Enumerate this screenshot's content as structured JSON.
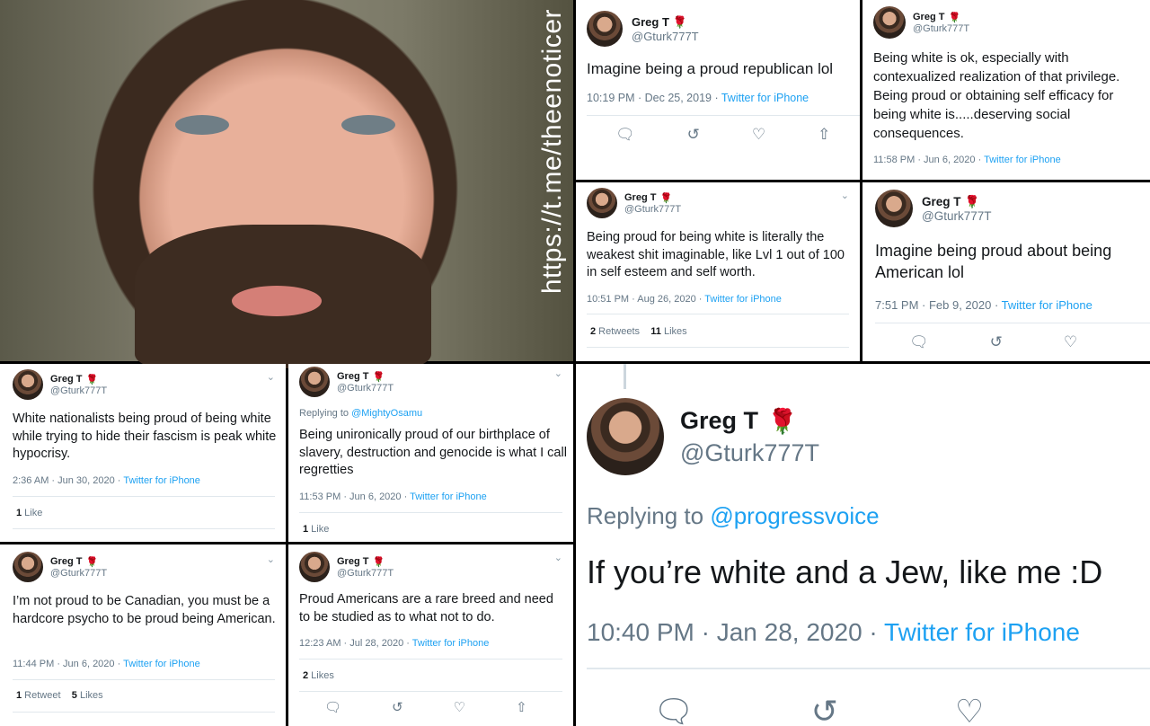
{
  "photo": {
    "watermark": "https://t.me/theenoticer"
  },
  "user": {
    "name": "Greg T",
    "handle": "@Gturk777T",
    "rose": "🌹"
  },
  "source": "Twitter for iPhone",
  "t1": {
    "text": "Imagine being a proud republican lol",
    "time": "10:19 PM · Dec 25, 2019 · "
  },
  "t2": {
    "text": "Being white is ok, especially with contexualized realization of that privilege. Being proud or obtaining self efficacy for being white is.....deserving social consequences.",
    "time": "11:58 PM · Jun 6, 2020 · "
  },
  "t3": {
    "text": "Being proud for being white is literally the weakest shit imaginable, like Lvl 1 out of 100 in self esteem and self worth.",
    "time": "10:51 PM · Aug 26, 2020 · ",
    "retweets": "2",
    "retweets_label": " Retweets",
    "likes": "11",
    "likes_label": " Likes"
  },
  "t4": {
    "text": "Imagine being proud about being American lol",
    "time": "7:51 PM · Feb 9, 2020 · "
  },
  "t5": {
    "text": "White nationalists being proud of being white while trying to hide their fascism is peak white hypocrisy.",
    "time": "2:36 AM · Jun 30, 2020 · ",
    "likes": "1",
    "likes_label": " Like"
  },
  "t6": {
    "replying": "Replying to ",
    "replying_to": "@MightyOsamu",
    "text": "Being unironically proud of our birthplace of slavery, destruction and genocide is what I call regretties",
    "time": "11:53 PM · Jun 6, 2020 · ",
    "likes": "1",
    "likes_label": " Like"
  },
  "t7": {
    "replying": "Replying to ",
    "replying_to": "@progressvoice",
    "text": "If you’re white and a Jew, like me :D",
    "time": "10:40 PM · Jan 28, 2020 · "
  },
  "t8": {
    "text": "I’m not proud to be Canadian, you must be a hardcore psycho to be proud being American.",
    "time": "11:44 PM · Jun 6, 2020 · ",
    "retweets": "1",
    "retweets_label": " Retweet",
    "likes": "5",
    "likes_label": " Likes"
  },
  "t9": {
    "text": "Proud Americans are a rare breed and need to be studied as to what not to do.",
    "time": "12:23 AM · Jul 28, 2020 · ",
    "likes": "2",
    "likes_label": " Likes"
  },
  "icons": {
    "reply": "reply-icon",
    "retweet": "retweet-icon",
    "like": "like-icon",
    "share": "share-icon",
    "more": "chevron-down-icon"
  },
  "colors": {
    "link": "#1da1f2",
    "muted": "#657786",
    "rose": "#c8102e"
  }
}
